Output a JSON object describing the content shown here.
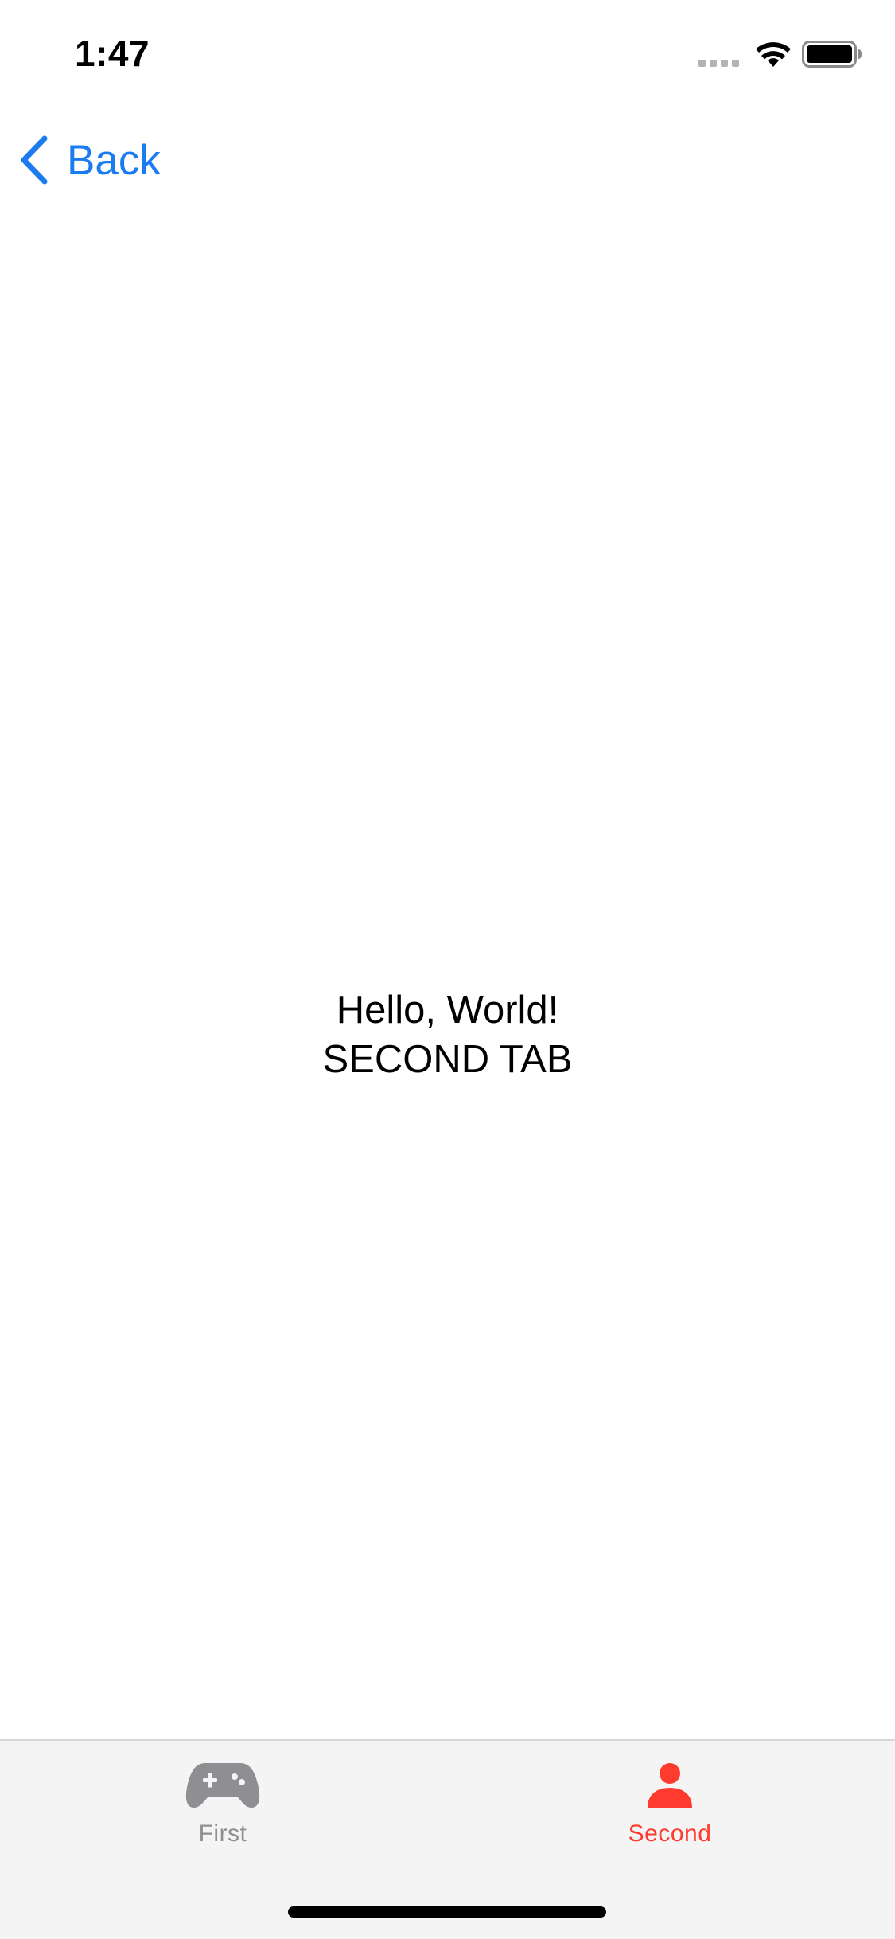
{
  "status_bar": {
    "time": "1:47"
  },
  "nav_bar": {
    "back_label": "Back",
    "accent_color": "#1a7cf0"
  },
  "main": {
    "line1": "Hello, World!",
    "line2": "SECOND TAB"
  },
  "tab_bar": {
    "tabs": [
      {
        "label": "First",
        "icon": "gamecontroller-icon",
        "selected": false,
        "color": "#8e8e93"
      },
      {
        "label": "Second",
        "icon": "person-icon",
        "selected": true,
        "color": "#ff3b30"
      }
    ]
  }
}
